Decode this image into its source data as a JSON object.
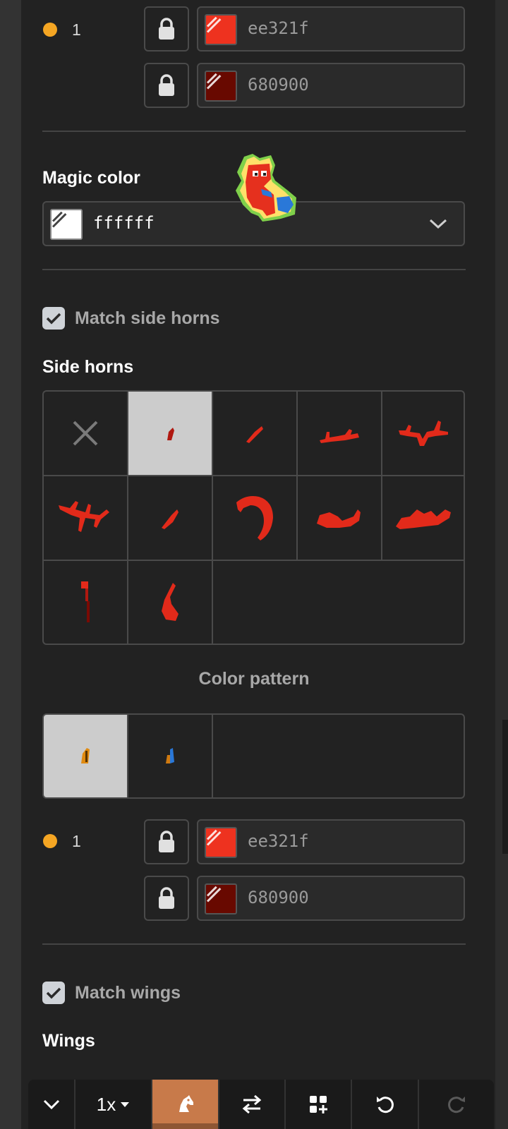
{
  "body_colors": [
    {
      "index": "1",
      "rows": [
        {
          "hex": "ee321f",
          "color": "#ee321f"
        },
        {
          "hex": "680900",
          "color": "#680900"
        }
      ]
    }
  ],
  "magic_color": {
    "label": "Magic color",
    "hex": "ffffff",
    "color": "#ffffff"
  },
  "match_side_horns": {
    "label": "Match side horns",
    "checked": true
  },
  "side_horns": {
    "label": "Side horns",
    "options": [
      "none",
      "side-horn-1",
      "side-horn-2",
      "side-horn-3",
      "side-horn-4",
      "side-horn-5",
      "side-horn-6",
      "side-horn-7",
      "side-horn-8",
      "side-horn-9",
      "side-horn-10",
      "side-horn-11"
    ],
    "selected_index": 1
  },
  "color_pattern": {
    "label": "Color pattern",
    "options": [
      "pattern-orange",
      "pattern-blue"
    ],
    "selected_index": 0
  },
  "pattern_colors": [
    {
      "index": "1",
      "rows": [
        {
          "hex": "ee321f",
          "color": "#ee321f"
        },
        {
          "hex": "680900",
          "color": "#680900"
        }
      ]
    }
  ],
  "match_wings": {
    "label": "Match wings",
    "checked": true
  },
  "wings": {
    "label": "Wings"
  },
  "toolbar": {
    "zoom_label": "1x",
    "items": [
      "chevron-down-icon",
      "zoom-select",
      "horse-head-icon",
      "swap-icon",
      "add-grid-icon",
      "undo-icon",
      "redo-icon"
    ],
    "active_item": "horse-head-icon"
  },
  "colors": {
    "accent": "#c87a4a",
    "dot": "#f5a623",
    "horn_red": "#e22a1a"
  }
}
